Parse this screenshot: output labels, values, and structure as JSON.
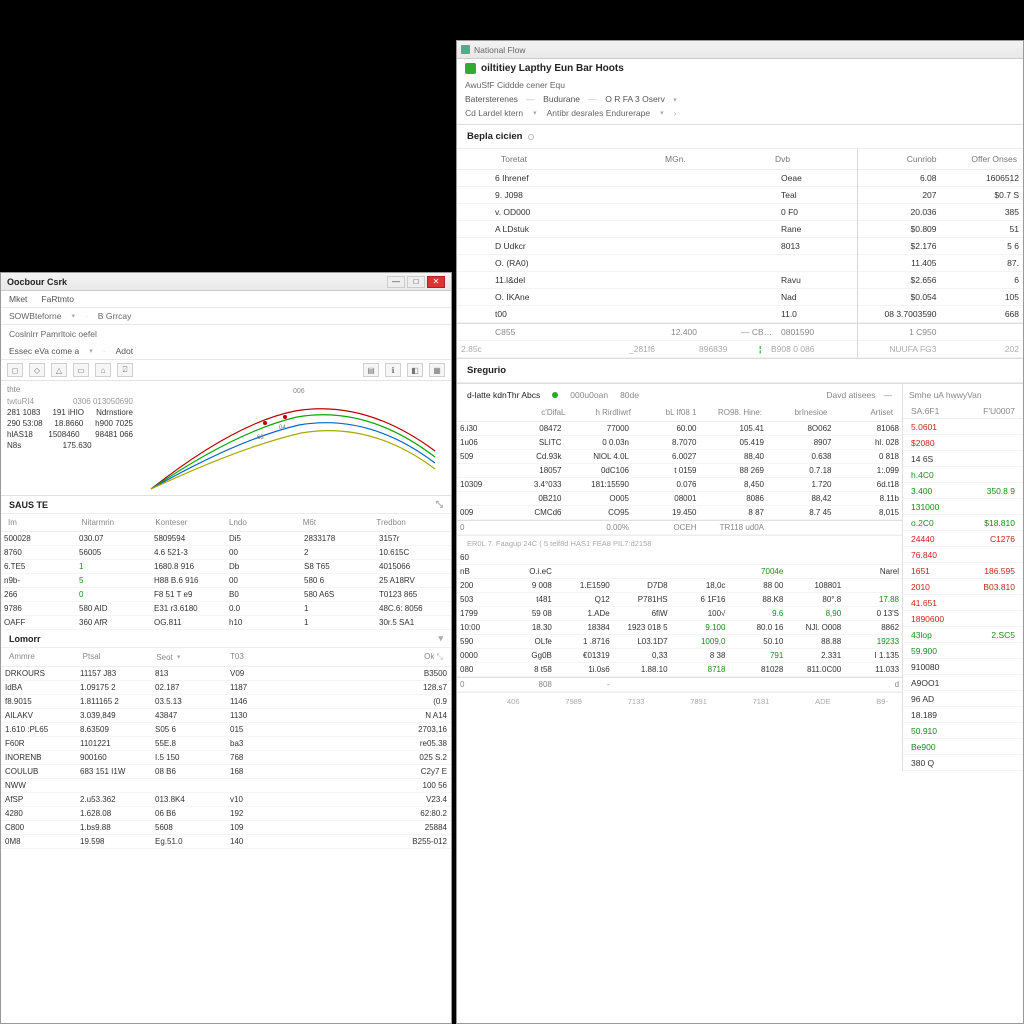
{
  "right": {
    "titlebar": "National Flow",
    "app_title": "oiltitiey Lapthy Eun Bar Hoots",
    "crumb1": "AwuSfF Ciddde cener Equ",
    "crumb2a": "Batersterenes",
    "crumb2b": "Budurane",
    "crumb2c": "O R FA 3 Oserv",
    "crumb3a": "Cd Lardel ktern",
    "crumb3b": "Antibr desrales  Endurerape",
    "section_hd": "Bepla cicien",
    "hdr_main": [
      "",
      "Toretat",
      "MGn.",
      "",
      "Dvb"
    ],
    "hdr_side": [
      "Cunriob",
      "Offer Onses"
    ],
    "rows_main": [
      [
        "",
        "6 Ihrenef",
        "",
        "",
        "Oeae"
      ],
      [
        "",
        "9. J098",
        "",
        "",
        "Teal"
      ],
      [
        "",
        "v. OD000",
        "",
        "",
        "0 F0"
      ],
      [
        "",
        "A  LDstuk",
        "",
        "",
        "Rane"
      ],
      [
        "",
        "D  Udkcr",
        "",
        "",
        "8013"
      ],
      [
        "",
        "O. (RA0)",
        "",
        "",
        ""
      ],
      [
        "",
        "11.l&del",
        "",
        "",
        "Ravu"
      ],
      [
        "",
        "O. IKAne",
        "",
        "",
        "Nad"
      ],
      [
        "",
        "t00",
        "",
        "",
        "11.0"
      ]
    ],
    "rows_main_total": [
      "",
      "C855",
      "12.400",
      "— CB18",
      "0801590"
    ],
    "rows_main_foot": [
      "2.85c",
      "",
      "_281f6",
      "896839",
      "B908 0 086"
    ],
    "rows_side": [
      [
        "6.08",
        "1606512"
      ],
      [
        "207",
        "$0.7 S"
      ],
      [
        "20.036",
        "385"
      ],
      [
        "$0.809",
        "51"
      ],
      [
        "$2.176",
        "5 6"
      ],
      [
        "11.405",
        "87."
      ],
      [
        "$2.656",
        "6"
      ],
      [
        "$0.054",
        "105"
      ],
      [
        "08 3.7003590",
        "668"
      ]
    ],
    "rows_side_total": "1 C950",
    "rows_side_foot": [
      "NUUFA FG3",
      "202"
    ],
    "s_hd": "Sregurio",
    "sub_tabs": {
      "a": "d-latte kdnThr Abcs",
      "b": "000u0oan",
      "c": "80de",
      "d": "Davd atisees",
      "e": "Smhe uA hwwyVan"
    },
    "grid_hdr": [
      "",
      "c'DifaL",
      "h Rirdliwrf",
      "bL If08 1",
      "RO98. Hine:",
      "brInesioe",
      "Artiset"
    ],
    "grid_rows": [
      [
        "6.i30",
        "08472",
        "77000",
        "60.00",
        "105.41",
        "8O062",
        "81068"
      ],
      [
        "1u06",
        "SLITC",
        "0 0.03n",
        "8.7070",
        "05.419",
        "8907",
        "hl. 028"
      ],
      [
        "509",
        "Cd.93k",
        "NlOL 4.0L",
        "6.0027",
        "88,40",
        "0.638",
        "0 818"
      ],
      [
        "",
        "18057",
        "0dC106",
        "t 0159",
        "88 269",
        "0.7.18",
        "1:.099"
      ],
      [
        "10309",
        "3.4°033",
        "181:15590",
        "0.076",
        "8,450",
        "1.720",
        "6d.t18"
      ],
      [
        "",
        "0B210",
        "O005",
        "08001",
        "8086",
        "88,42",
        "8.11b"
      ],
      [
        "009",
        "CMCd6",
        "CO95",
        "19.450",
        "8 87",
        "8.7 45",
        "8,015"
      ]
    ],
    "grid_sum": [
      "0",
      "",
      "0.00%",
      "OCEH",
      "TR118  ud0A",
      "",
      ""
    ],
    "footnote": "ER0L      7. Faagup 24C  ( 5 telf8d HAS1  FEA8  PIL7:d2158",
    "grid_rows2": [
      [
        "60",
        "",
        "",
        "",
        "",
        "",
        "",
        ""
      ],
      [
        "nB",
        "O.i.eC",
        "",
        "",
        "",
        "7004e",
        "",
        "Narel"
      ],
      [
        "200",
        "9 008",
        "1.E1590",
        "D7D8",
        "18,0c",
        "88 00",
        "108801",
        ""
      ],
      [
        "503",
        "t481",
        "Q12",
        "P781HS",
        "6 1F16",
        "88.K8",
        "80°.8",
        "17.88"
      ],
      [
        "1799",
        "59 08",
        "1.ADe",
        "6fiW",
        "100√",
        "9.6",
        "8,90",
        "0 13'S"
      ],
      [
        "10:00",
        "18.30",
        "18384",
        "1923 018 5",
        "9.100",
        "80.0 16",
        "NJl. O008",
        "8862"
      ],
      [
        "590",
        "OLfe",
        "1 .8716",
        "L03.1D7",
        "1009,0",
        "50.10",
        "88.88",
        "19233"
      ],
      [
        "0000",
        "Gg0B",
        "€01319",
        "0,33",
        "8 38",
        "791",
        "2.331",
        "I 1.135"
      ],
      [
        "080",
        "8 t58",
        "1i.0s6",
        "1.88.10",
        "8718",
        "81028",
        "811.0C00",
        "11.033"
      ]
    ],
    "grid_sum2": [
      "0",
      "808",
      "-",
      "",
      "",
      "",
      "",
      "d"
    ],
    "axis": [
      "406",
      "7989",
      "7133",
      "7891",
      "7181",
      "ADE",
      "B9-"
    ],
    "right_list_hdr": [
      "SA.6F1",
      "F'U0007"
    ],
    "right_list": [
      {
        "c": "red",
        "v1": "5.0601",
        "v2": ""
      },
      {
        "c": "red",
        "v1": "$2080",
        "v2": ""
      },
      {
        "c": "",
        "v1": "14 6S",
        "v2": ""
      },
      {
        "c": "green",
        "v1": "h.4C0",
        "v2": ""
      },
      {
        "c": "green",
        "v1": "3.400",
        "v2": "350.8 9"
      },
      {
        "c": "green",
        "v1": "131000",
        "v2": ""
      },
      {
        "c": "green",
        "v1": "o.2C0",
        "v2": "$18.810"
      },
      {
        "c": "red",
        "v1": "24440",
        "v2": "C1276"
      },
      {
        "c": "red",
        "v1": "76.840",
        "v2": ""
      },
      {
        "c": "red",
        "v1": "1651",
        "v2": "186.595"
      },
      {
        "c": "red",
        "v1": "2010",
        "v2": "B03.810"
      },
      {
        "c": "red",
        "v1": "41.651",
        "v2": ""
      },
      {
        "c": "red",
        "v1": "1890600",
        "v2": ""
      },
      {
        "c": "green",
        "v1": "43lop",
        "v2": "2.SC5"
      },
      {
        "c": "green",
        "v1": "59.900",
        "v2": ""
      },
      {
        "c": "",
        "v1": "910080",
        "v2": ""
      },
      {
        "c": "",
        "v1": "A9OO1",
        "v2": ""
      },
      {
        "c": "",
        "v1": "96 AD",
        "v2": ""
      },
      {
        "c": "",
        "v1": "18.189",
        "v2": ""
      },
      {
        "c": "green",
        "v1": "50.910",
        "v2": ""
      },
      {
        "c": "green",
        "v1": "Be900",
        "v2": ""
      },
      {
        "c": "",
        "v1": "380 Q",
        "v2": ""
      }
    ]
  },
  "left": {
    "title": "Oocbour Csrk",
    "menu": [
      "Mket",
      "FaRtmto"
    ],
    "ribbon_a": "SOWBteforne",
    "ribbon_b": "B Grrcay",
    "crumb": "Coslnlrr Pamrltoic oefel",
    "quick_a": "Essec eVa come a",
    "quick_b": "Adot",
    "legend_hdr": [
      "thte",
      ""
    ],
    "legend_hdr2": [
      "twtuRI4",
      "0306  013050690"
    ],
    "legend_rows": [
      [
        "281 1083",
        "191 iHIO",
        "Ndrnstiore"
      ],
      [
        "290 53:08",
        "18.8660",
        "h900 7025"
      ],
      [
        "hlAS18",
        "1508460",
        "98481 066"
      ],
      [
        "N8s",
        "175.630",
        ""
      ]
    ],
    "chart_labels": [
      "006",
      "63",
      "04"
    ],
    "saus_hd": "SAUS TE",
    "saus_hdr": [
      "Im",
      "Nitarmrin",
      "Konteser",
      "Lndo",
      "M6t",
      "Tredbon"
    ],
    "saus_rows": [
      [
        "500028",
        "030.07",
        "5809594",
        "Di5",
        "2833178",
        "3157r"
      ],
      [
        "8760",
        "56005",
        "4.6 521-3",
        "00",
        "2",
        "10.615C"
      ],
      [
        "6.TE5",
        "1",
        "1680.8 916",
        "Db",
        "S8 T65",
        "4015066"
      ],
      [
        "n9b-",
        "5",
        "H88 B.6 916",
        "00",
        "580 6",
        "25 A18RV"
      ],
      [
        "266",
        "0",
        "F8 51 T e9",
        "B0",
        "580 A6S",
        "T0123 865"
      ],
      [
        "9786",
        "580 AID",
        "E31 r3.6180",
        "0.0",
        "1",
        "48C.6: 8056"
      ],
      [
        "OAFF",
        "360 AfR",
        "OG.811",
        "h10",
        "1",
        "30r.5 SA1"
      ]
    ],
    "lamon_hd": "Lomorr",
    "lamon_hdr": [
      "Ammre",
      "Ptsal",
      "Seot",
      "T03",
      "",
      "Ok"
    ],
    "lamon_rows": [
      [
        "DRKOURS",
        "11157 J83",
        "813",
        "V09",
        "",
        "B3500"
      ],
      [
        "IdBA",
        "1.09175 2",
        "02.187",
        "1187",
        "",
        "128.s7"
      ],
      [
        "f8.9015",
        "1.811165 2",
        "03.5.13",
        "1146",
        "",
        "(0.9"
      ],
      [
        "AILAKV",
        "3.039,849",
        "43847",
        "1130",
        "",
        "N A14"
      ],
      [
        "1.610 :PL65",
        "8.63509",
        "S05 6",
        "015",
        "",
        "2703,16"
      ],
      [
        "F60R",
        "1101221",
        "55E.8",
        "ba3",
        "",
        "re05.38"
      ],
      [
        "INORENB",
        "900160",
        "I.5 150",
        "768",
        "",
        "025 S.2"
      ],
      [
        "COULUB",
        "683 151    I1W",
        "08 B6",
        "168",
        "",
        "C2y7 E"
      ],
      [
        "NWW",
        "",
        "",
        "",
        "",
        "100 56"
      ],
      [
        "AfSP",
        "2.u53.362",
        "013.8K4",
        "v10",
        "",
        "V23.4"
      ],
      [
        "4280",
        "1.628.08",
        "06 B6",
        "192",
        "",
        "62:80.2"
      ],
      [
        "C800",
        "1.bs9.88",
        "5608",
        "109",
        "",
        "25884"
      ],
      [
        "0M8",
        "19.598",
        "Eg.51.0",
        "140",
        "",
        "B255-012"
      ]
    ]
  },
  "chart_data": {
    "type": "line",
    "series_count": 4,
    "x_range": [
      0,
      100
    ],
    "y_range": [
      0,
      100
    ],
    "note": "multi-series arched curves; values not labeled on axes"
  }
}
